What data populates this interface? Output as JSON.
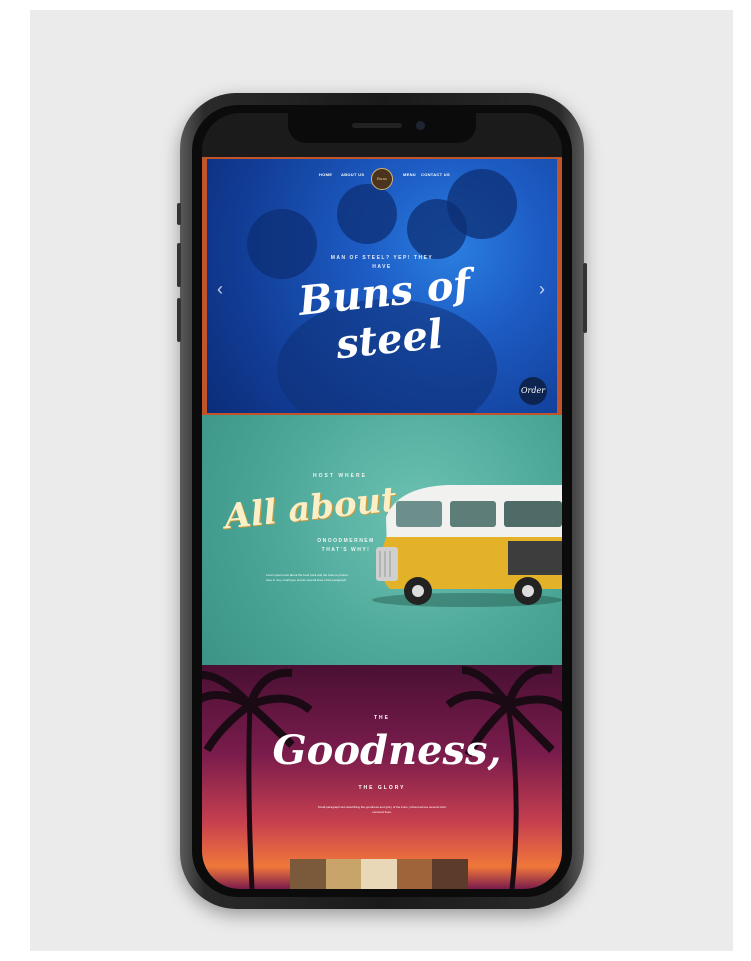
{
  "nav": {
    "items": [
      "HOME",
      "ABOUT US",
      "MENU",
      "CONTACT US"
    ],
    "logo_text": "Buns"
  },
  "hero": {
    "subtitle": "MAN OF STEEL? YEP! THEY",
    "subtitle2": "HAVE",
    "title": "Buns of steel",
    "prev_icon": "‹",
    "next_icon": "›",
    "badge_text": "Order"
  },
  "about": {
    "eyebrow": "HOST WHERE",
    "title": "All about",
    "subtitle": "ONOODMERNEM",
    "subtitle2": "THAT'S WHY!",
    "body": "Lorem ipsum text about the food truck and the buns is printed here in very small type across several lines of the paragraph."
  },
  "goodness": {
    "the": "THE",
    "title": "Goodness,",
    "glory": "THE GLORY",
    "body": "Small paragraph text describing the goodness and glory of the buns, printed across several short centered lines."
  },
  "colors": {
    "hero_accent": "#c2542a",
    "hero_blue": "#1d5cc4",
    "teal": "#4aa596",
    "sunset_top": "#4a1034",
    "sunset_glow": "#f0773a"
  }
}
